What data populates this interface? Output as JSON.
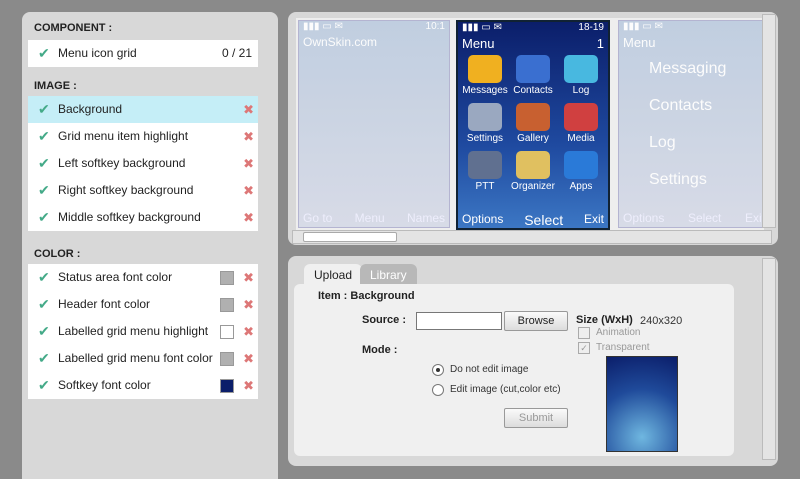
{
  "left": {
    "component_header": "COMPONENT :",
    "component_items": [
      {
        "label": "Menu icon grid",
        "count": "0 / 21"
      }
    ],
    "image_header": "IMAGE :",
    "image_items": [
      {
        "label": "Background",
        "selected": true
      },
      {
        "label": "Grid menu item highlight"
      },
      {
        "label": "Left softkey background"
      },
      {
        "label": "Right softkey background"
      },
      {
        "label": "Middle softkey background"
      }
    ],
    "color_header": "COLOR :",
    "color_items": [
      {
        "label": "Status area font color",
        "swatch": "#b0b0b0"
      },
      {
        "label": "Header font color",
        "swatch": "#b0b0b0"
      },
      {
        "label": "Labelled grid menu highlight",
        "swatch": "#ffffff"
      },
      {
        "label": "Labelled grid menu font color",
        "swatch": "#b0b0b0"
      },
      {
        "label": "Softkey font color",
        "swatch": "#0b1e6a"
      }
    ]
  },
  "preview": {
    "left_phone": {
      "watermark": "OwnSkin.com",
      "time": "10:1",
      "softkeys": [
        "Go to",
        "Menu",
        "Names"
      ]
    },
    "main_phone": {
      "time": "18-19",
      "title": "Menu",
      "num": "1",
      "items": [
        "Messages",
        "Contacts",
        "Log",
        "Settings",
        "Gallery",
        "Media",
        "PTT",
        "Organizer",
        "Apps"
      ],
      "softkeys": [
        "Options",
        "Select",
        "Exit"
      ]
    },
    "right_phone": {
      "title": "Menu",
      "items": [
        "Messaging",
        "Contacts",
        "Log",
        "Settings"
      ],
      "softkeys": [
        "Options",
        "Select",
        "Exit"
      ]
    }
  },
  "tabs": {
    "upload": "Upload",
    "library": "Library"
  },
  "form": {
    "item_label": "Item : Background",
    "source_label": "Source :",
    "source_value": "",
    "browse": "Browse",
    "size_label": "Size (WxH)",
    "size_value": "240x320",
    "animation": "Animation",
    "transparent": "Transparent",
    "mode_label": "Mode :",
    "mode_opt1": "Do not edit image",
    "mode_opt2": "Edit image (cut,color etc)",
    "submit": "Submit"
  },
  "colors": {
    "accent": "#c5eef7",
    "check": "#44aa88",
    "delete": "#dd7777"
  }
}
